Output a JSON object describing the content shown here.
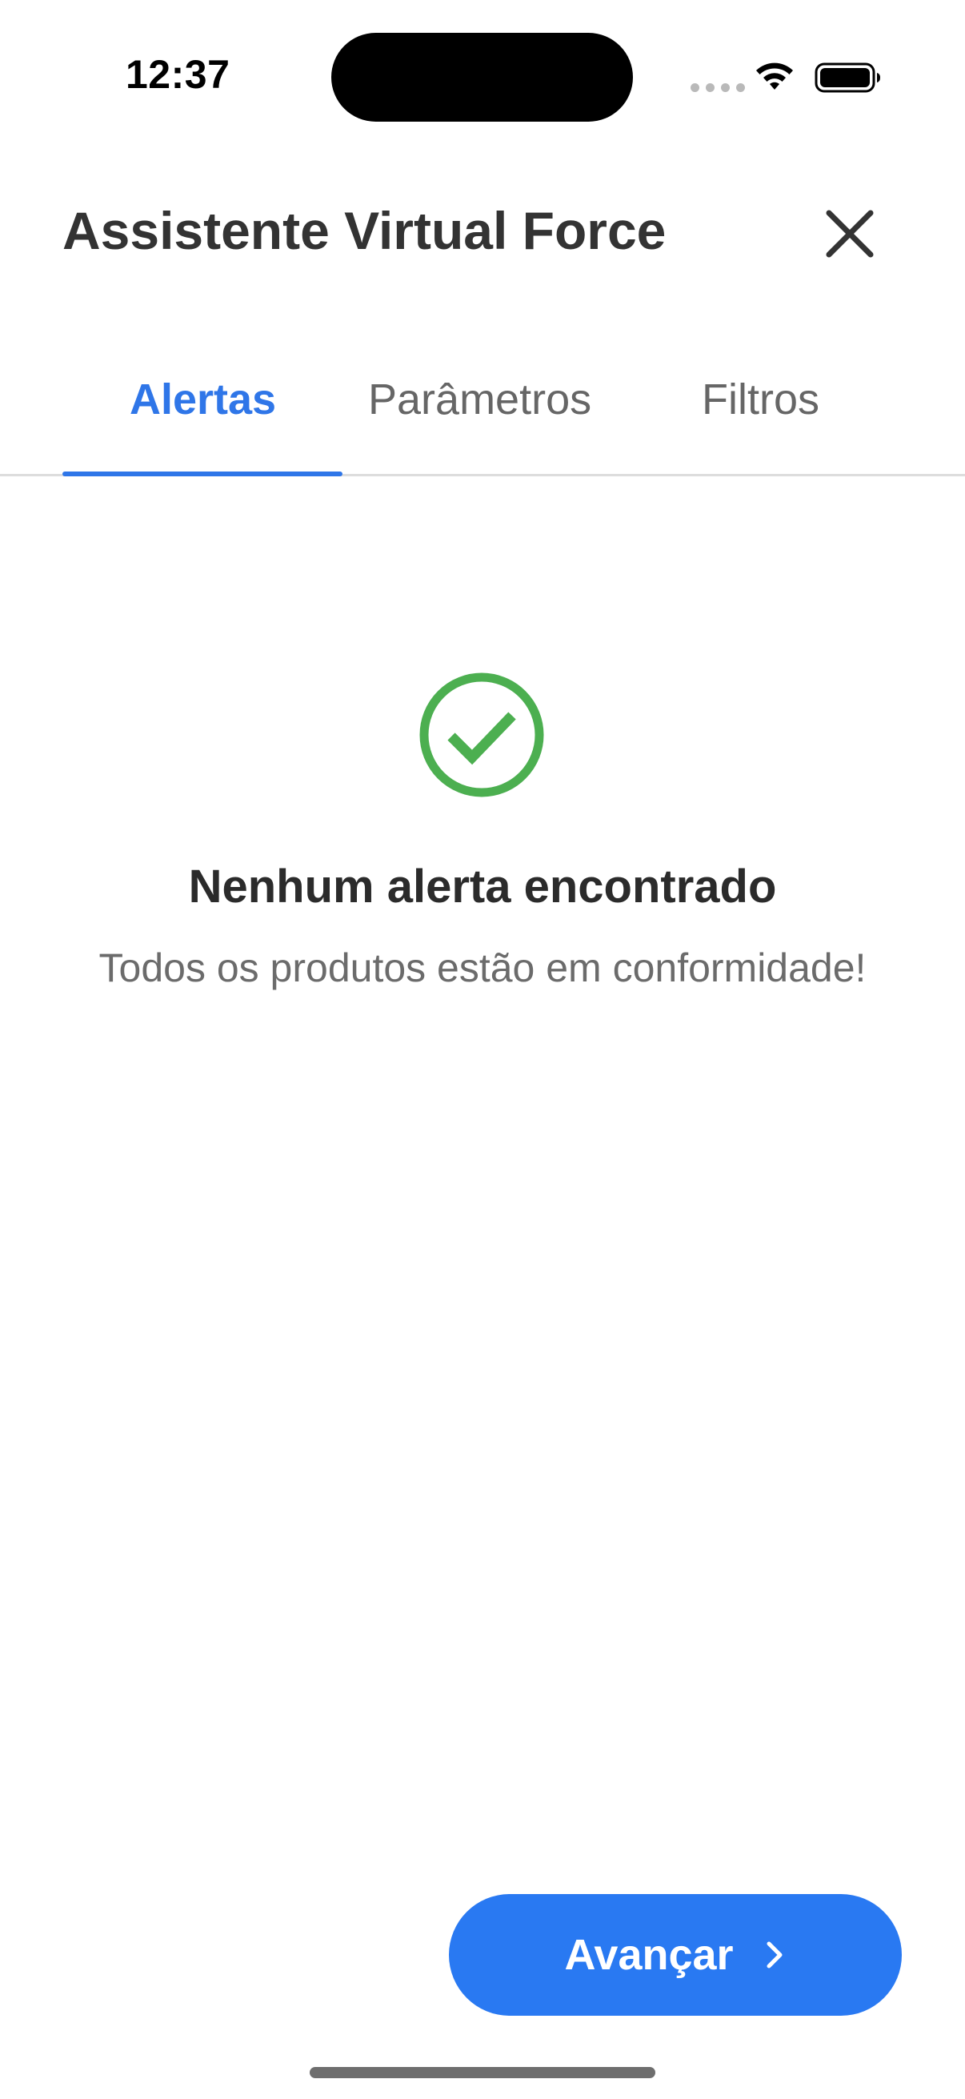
{
  "status_bar": {
    "time": "12:37",
    "icons": [
      "cellular-dots-icon",
      "wifi-icon",
      "battery-icon"
    ]
  },
  "header": {
    "title": "Assistente Virtual Force",
    "close_icon": "close-icon"
  },
  "tabs": [
    {
      "label": "Alertas",
      "active": true
    },
    {
      "label": "Parâmetros",
      "active": false
    },
    {
      "label": "Filtros",
      "active": false
    }
  ],
  "empty_state": {
    "icon": "check-circle-icon",
    "title": "Nenhum alerta encontrado",
    "subtitle": "Todos os produtos estão em conformidade!"
  },
  "footer": {
    "next_label": "Avançar",
    "next_icon": "chevron-right-icon"
  },
  "colors": {
    "accent": "#2f76e8",
    "button": "#2979f2",
    "success": "#4caf50",
    "title_text": "#333333",
    "muted_text": "#6b6b6b"
  }
}
